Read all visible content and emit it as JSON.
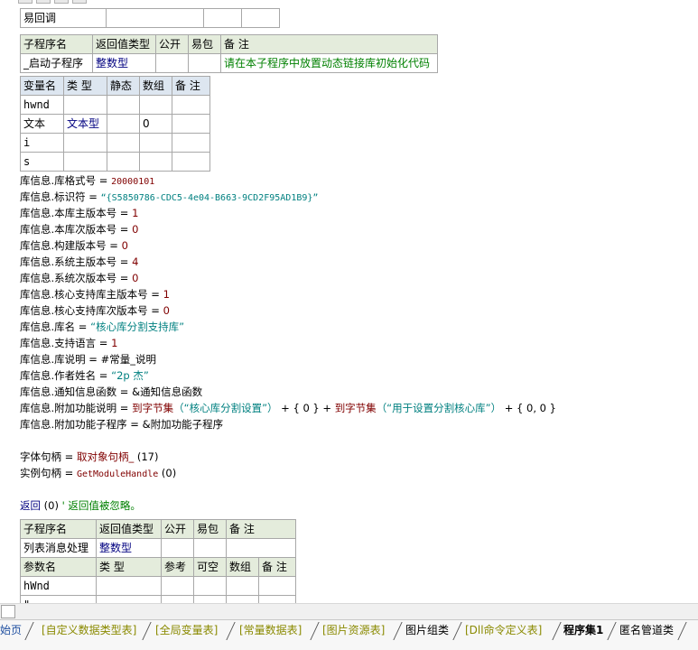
{
  "top_table": {
    "cells": [
      "易回调",
      "",
      "",
      ""
    ]
  },
  "sub1": {
    "headers": [
      "子程序名",
      "返回值类型",
      "公开",
      "易包",
      "备 注"
    ],
    "row": {
      "name": "_启动子程序",
      "type": "整数型",
      "public": "",
      "easy": "",
      "remark": "请在本子程序中放置动态链接库初始化代码"
    }
  },
  "vars": {
    "headers": [
      "变量名",
      "类 型",
      "静态",
      "数组",
      "备 注"
    ],
    "rows": [
      {
        "name": "hwnd",
        "type": "",
        "static": "",
        "array": "",
        "remark": ""
      },
      {
        "name": "文本",
        "type": "文本型",
        "static": "",
        "array": "0",
        "remark": ""
      },
      {
        "name": "i",
        "type": "",
        "static": "",
        "array": "",
        "remark": ""
      },
      {
        "name": "s",
        "type": "",
        "static": "",
        "array": "",
        "remark": ""
      }
    ]
  },
  "code": {
    "l1": {
      "a": "库信息.库格式号",
      "b": " = ",
      "c": "20000101"
    },
    "l2": {
      "a": "库信息.标识符",
      "b": " = ",
      "c": "“{S5850786-CDC5-4e04-B663-9CD2F95AD1B9}”"
    },
    "l3": {
      "a": "库信息.本库主版本号",
      "b": " = ",
      "c": "1"
    },
    "l4": {
      "a": "库信息.本库次版本号",
      "b": " = ",
      "c": "0"
    },
    "l5": {
      "a": "库信息.构建版本号",
      "b": " = ",
      "c": "0"
    },
    "l6": {
      "a": "库信息.系统主版本号",
      "b": " = ",
      "c": "4"
    },
    "l7": {
      "a": "库信息.系统次版本号",
      "b": " = ",
      "c": "0"
    },
    "l8": {
      "a": "库信息.核心支持库主版本号",
      "b": " = ",
      "c": "1"
    },
    "l9": {
      "a": "库信息.核心支持库次版本号",
      "b": " = ",
      "c": "0"
    },
    "l10": {
      "a": "库信息.库名",
      "b": " = ",
      "c": "“核心库分割支持库”"
    },
    "l11": {
      "a": "库信息.支持语言",
      "b": " = ",
      "c": "1"
    },
    "l12": {
      "a": "库信息.库说明",
      "b": " = ",
      "c": "#常量_说明"
    },
    "l13": {
      "a": "库信息.作者姓名",
      "b": " = ",
      "c": "“2p 杰”"
    },
    "l14": {
      "a": "库信息.通知信息函数",
      "b": " = ",
      "c": "&通知信息函数"
    },
    "l15": {
      "a": "库信息.附加功能说明",
      "b": " = ",
      "f1": "到字节集",
      "s1": "（“核心库分割设置”）",
      "m1": " + { 0 } + ",
      "f2": "到字节集",
      "s2": "（“用于设置分割核心库”）",
      "m2": " + { 0, 0 }"
    },
    "l16": {
      "a": "库信息.附加功能子程序",
      "b": " = ",
      "c": "&附加功能子程序"
    },
    "l17": {
      "a": "字体句柄",
      "b": " = ",
      "f": "取对象句柄_",
      "c": " (17)"
    },
    "l18": {
      "a": "实例句柄",
      "b": " = ",
      "f": "GetModuleHandle",
      "c": " (0)"
    },
    "l19": {
      "kw": "返回",
      "c": " (0)",
      "cm": " ' 返回值被忽略。"
    }
  },
  "sub2": {
    "headers": [
      "子程序名",
      "返回值类型",
      "公开",
      "易包",
      "备 注"
    ],
    "row": {
      "name": "列表消息处理",
      "type": "整数型",
      "public": "",
      "easy": "",
      "remark": ""
    },
    "param_headers": [
      "参数名",
      "类 型",
      "参考",
      "可空",
      "数组",
      "备 注"
    ],
    "params": [
      {
        "name": "hWnd"
      },
      {
        "name": "\""
      }
    ]
  },
  "tabs": [
    {
      "label": "始页",
      "style": "blue"
    },
    {
      "label": "[自定义数据类型表]",
      "style": "olive"
    },
    {
      "label": "[全局变量表]",
      "style": "olive"
    },
    {
      "label": "[常量数据表]",
      "style": "olive"
    },
    {
      "label": "[图片资源表]",
      "style": "olive"
    },
    {
      "label": "图片组类",
      "style": "black"
    },
    {
      "label": "[Dll命令定义表]",
      "style": "olive"
    },
    {
      "label": "程序集1",
      "style": "active"
    },
    {
      "label": "匿名管道类",
      "style": "black"
    }
  ]
}
